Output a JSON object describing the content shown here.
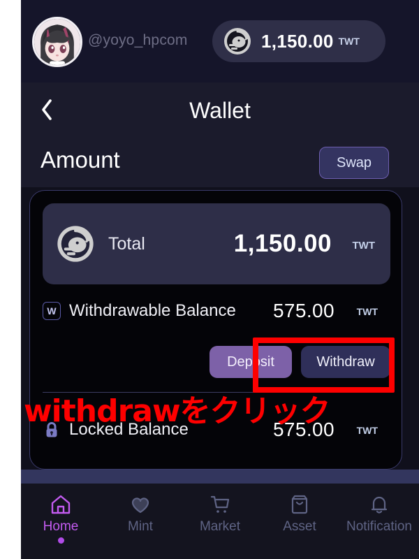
{
  "account": {
    "handle": "@yoyo_hpcom",
    "avatar_icon": "user-avatar-anime",
    "balance_pill": {
      "coin_icon": "twt-coin-icon",
      "amount": "1,150.00",
      "unit": "TWT"
    }
  },
  "header": {
    "back_icon": "chevron-left-icon",
    "title": "Wallet"
  },
  "amount_section": {
    "heading": "Amount",
    "swap_label": "Swap"
  },
  "wallet_card": {
    "total": {
      "coin_icon": "twt-coin-icon",
      "label": "Total",
      "amount": "1,150.00",
      "unit": "TWT"
    },
    "withdrawable": {
      "badge_icon": "w-badge-icon",
      "label": "Withdrawable Balance",
      "amount": "575.00",
      "unit": "TWT"
    },
    "locked": {
      "lock_icon": "lock-icon",
      "label": "Locked Balance",
      "amount": "575.00",
      "unit": "TWT"
    },
    "actions": {
      "deposit_label": "Deposit",
      "withdraw_label": "Withdraw"
    }
  },
  "annotation": {
    "text": "withdrawをクリック",
    "color": "#fe0000"
  },
  "bottom_nav": {
    "items": [
      {
        "label": "Home",
        "icon": "home-icon",
        "active": true
      },
      {
        "label": "Mint",
        "icon": "heart-icon",
        "active": false
      },
      {
        "label": "Market",
        "icon": "shopping-cart-icon",
        "active": false
      },
      {
        "label": "Asset",
        "icon": "bag-icon",
        "active": false
      },
      {
        "label": "Notification",
        "icon": "bell-icon",
        "active": false
      }
    ]
  },
  "colors": {
    "accent_purple": "#b14ce8",
    "deposit_button": "#7d61a8",
    "withdraw_button": "#2f2f59",
    "annotation_red": "#fe0000",
    "page_background": "#10101c"
  }
}
